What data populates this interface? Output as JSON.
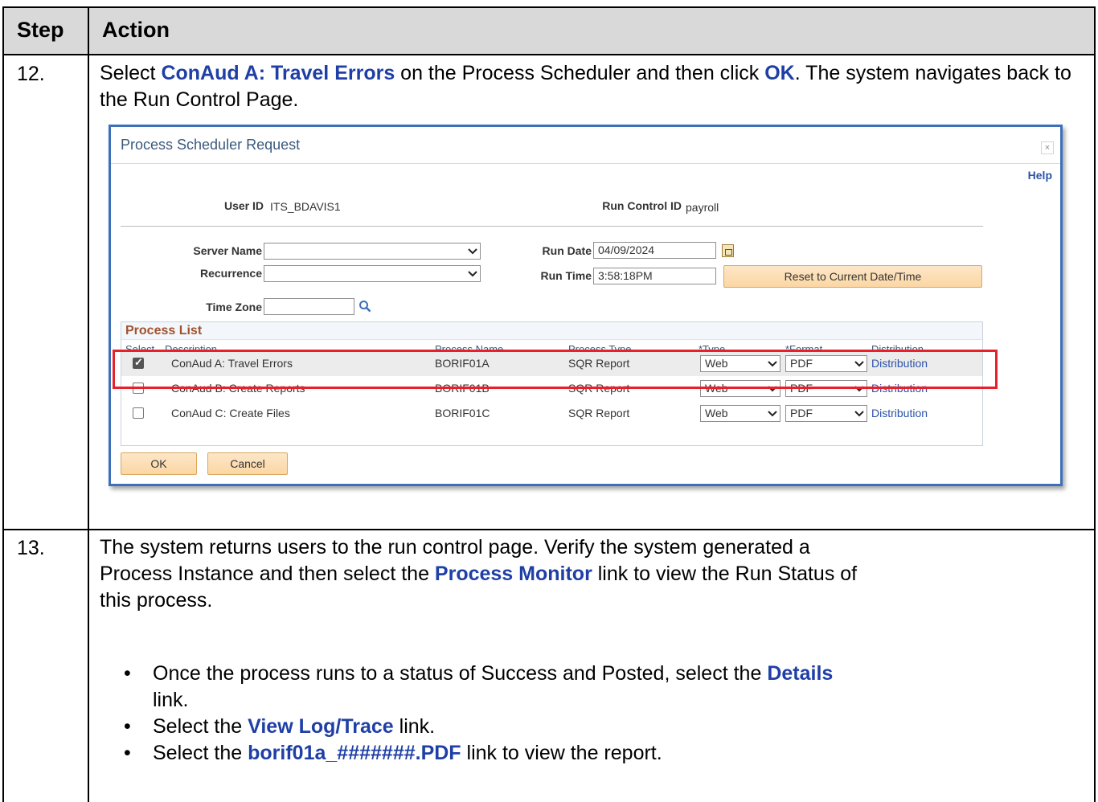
{
  "header": {
    "step": "Step",
    "action": "Action"
  },
  "step12": {
    "number": "12.",
    "text_parts": [
      "Select ",
      "ConAud A: Travel Errors",
      " on the Process Scheduler and then click ",
      "OK",
      ". The system navigates back to the Run Control Page."
    ]
  },
  "dialog": {
    "title": "Process Scheduler Request",
    "close": "×",
    "help": "Help",
    "user_id_label": "User ID",
    "user_id": "ITS_BDAVIS1",
    "run_control_label": "Run Control ID",
    "run_control": "payroll",
    "server_name_label": "Server Name",
    "server_name": "",
    "recurrence_label": "Recurrence",
    "recurrence": "",
    "time_zone_label": "Time Zone",
    "time_zone": "",
    "run_date_label": "Run Date",
    "run_date": "04/09/2024",
    "run_time_label": "Run Time",
    "run_time": "3:58:18PM",
    "reset_button": "Reset to Current Date/Time",
    "process_list": {
      "title": "Process List",
      "columns": [
        "Select",
        "Description",
        "Process Name",
        "Process Type",
        "*Type",
        "*Format",
        "Distribution"
      ],
      "rows": [
        {
          "checked": true,
          "description": "ConAud A: Travel Errors",
          "process_name": "BORIF01A",
          "process_type": "SQR Report",
          "type": "Web",
          "format": "PDF",
          "distribution": "Distribution"
        },
        {
          "checked": false,
          "description": "ConAud B: Create Reports",
          "process_name": "BORIF01B",
          "process_type": "SQR Report",
          "type": "Web",
          "format": "PDF",
          "distribution": "Distribution"
        },
        {
          "checked": false,
          "description": "ConAud C: Create Files",
          "process_name": "BORIF01C",
          "process_type": "SQR Report",
          "type": "Web",
          "format": "PDF",
          "distribution": "Distribution"
        }
      ]
    },
    "ok_button": "OK",
    "cancel_button": "Cancel"
  },
  "step13": {
    "number": "13.",
    "line1": "The system returns users to the run control page. Verify the system generated a",
    "line2_parts": [
      "Process Instance and then select the ",
      "Process Monitor",
      " link to view the Run Status of"
    ],
    "line3": "this process.",
    "bullets": [
      {
        "parts": [
          "Once the process runs to a status of Success and Posted, select the ",
          "Details",
          " link."
        ]
      },
      {
        "parts": [
          "Select the ",
          "View Log/Trace",
          " link."
        ]
      },
      {
        "parts": [
          "Select the ",
          "borif01a_#######.PDF",
          " link to view the report."
        ]
      }
    ]
  },
  "colors": {
    "highlight_blue": "#1f3fa6",
    "dialog_border": "#3c70bb",
    "red_box": "#e8202a",
    "button_orange": "#fbd6a3"
  }
}
